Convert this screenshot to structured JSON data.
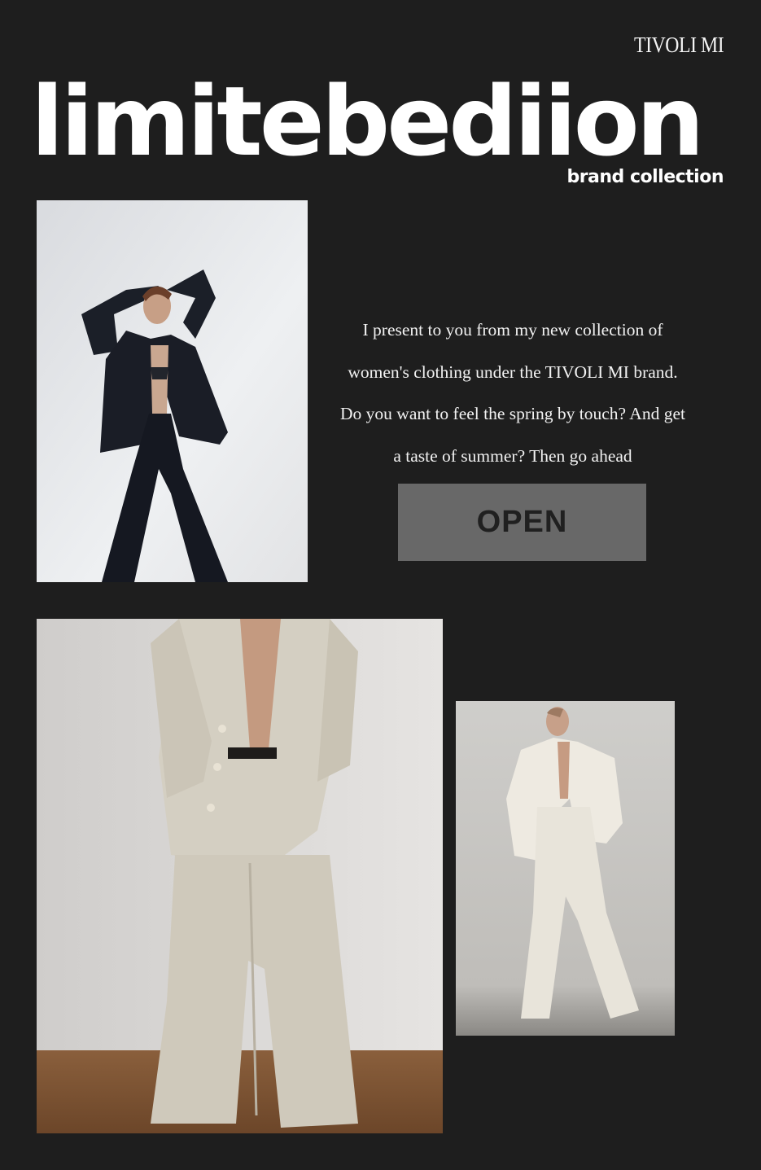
{
  "header": {
    "brand": "TIVOLI MI",
    "headline": "limitebediion",
    "subhead": "brand collection"
  },
  "intro": {
    "lines": [
      "I present to you from my new collection of",
      "women's clothing under the TIVOLI MI brand.",
      "Do you want to feel the spring by touch? And get",
      "a taste of summer? Then go ahead"
    ]
  },
  "cta": {
    "label": "OPEN"
  },
  "colors": {
    "background": "#1e1e1e",
    "text": "#ffffff",
    "button": "#686868",
    "button_text": "#202020"
  }
}
